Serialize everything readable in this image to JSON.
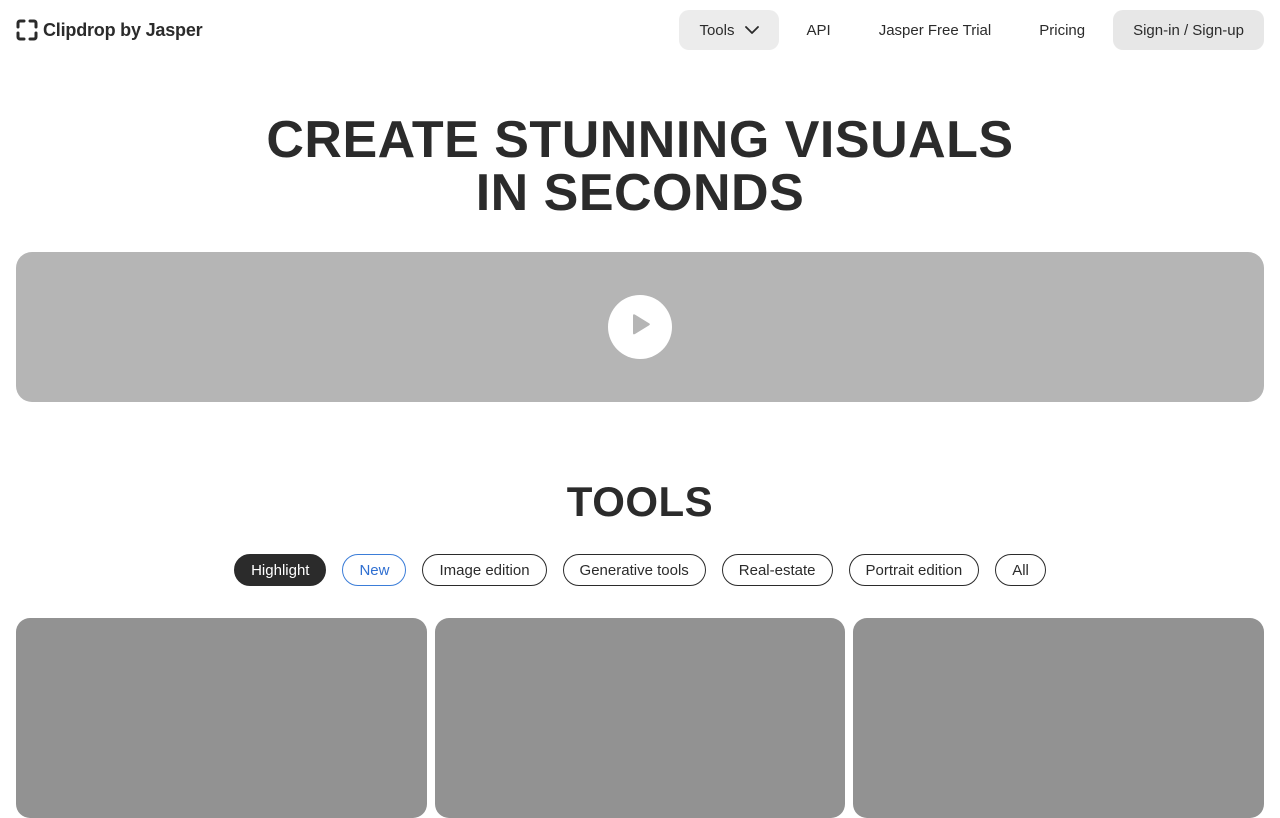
{
  "brand": {
    "name": "Clipdrop by Jasper"
  },
  "nav": {
    "tools_label": "Tools",
    "api_label": "API",
    "trial_label": "Jasper Free Trial",
    "pricing_label": "Pricing",
    "signin_label": "Sign-in / Sign-up"
  },
  "hero": {
    "title_line1": "CREATE STUNNING VISUALS",
    "title_line2": "IN SECONDS"
  },
  "tools": {
    "title": "TOOLS",
    "filters": [
      "Highlight",
      "New",
      "Image edition",
      "Generative tools",
      "Real-estate",
      "Portrait edition",
      "All"
    ],
    "active_filter": "Highlight"
  },
  "colors": {
    "text": "#2b2b2b",
    "accent_blue": "#2f6fd1",
    "video_bg": "#b5b5b5",
    "card_bg": "#929292"
  }
}
